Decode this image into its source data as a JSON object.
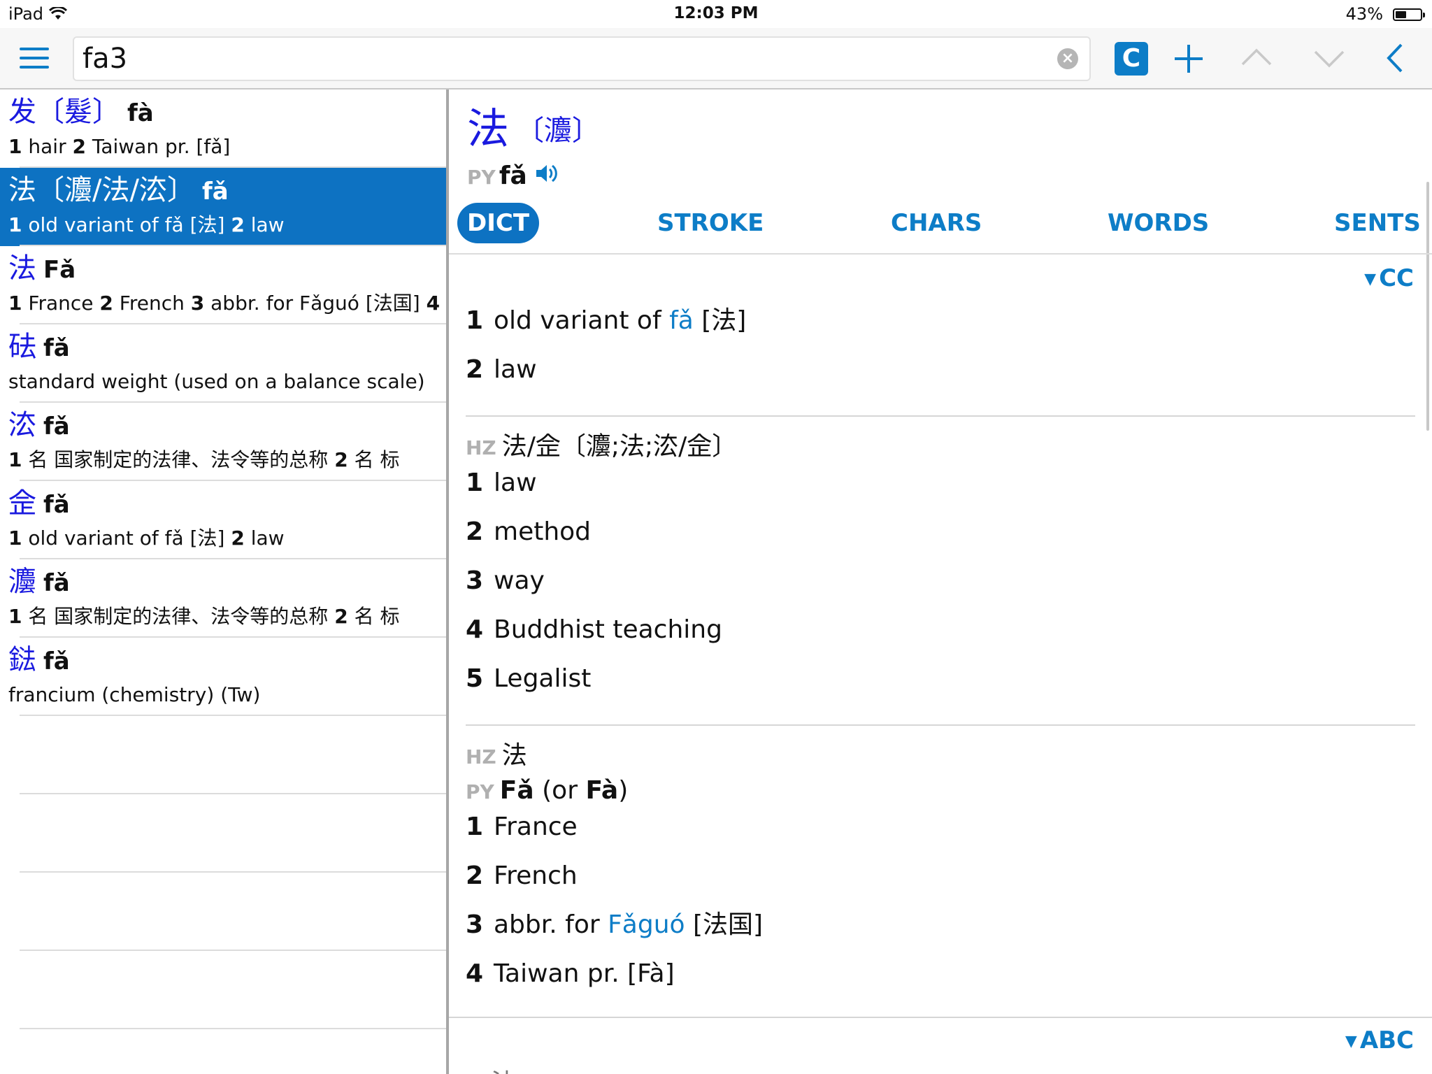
{
  "status_bar": {
    "device": "iPad",
    "time": "12:03 PM",
    "battery_percent": "43%",
    "battery_level": 0.43
  },
  "toolbar": {
    "search_value": "fa3",
    "c_button_label": "C",
    "accent_color": "#0d7dc7"
  },
  "results": [
    {
      "hz": "发",
      "trad": "〔髮〕",
      "py": "fà",
      "defs": [
        {
          "num": "1",
          "text": " hair "
        },
        {
          "num": "2",
          "text": " Taiwan pr. [fǎ]"
        }
      ]
    },
    {
      "hz": "法",
      "trad": "〔灋/法/㳒〕",
      "py": "fǎ",
      "selected": true,
      "defs": [
        {
          "num": "1",
          "text": " old variant of fǎ [法] "
        },
        {
          "num": "2",
          "text": " law"
        }
      ]
    },
    {
      "hz": "法",
      "trad": "",
      "py": "Fǎ",
      "defs": [
        {
          "num": "1",
          "text": " France "
        },
        {
          "num": "2",
          "text": " French "
        },
        {
          "num": "3",
          "text": " abbr. for Fǎguó [法国] "
        },
        {
          "num": "4",
          "text": ""
        }
      ]
    },
    {
      "hz": "砝",
      "trad": "",
      "py": "fǎ",
      "defs": [
        {
          "num": "",
          "text": "standard weight (used on a balance scale)"
        }
      ]
    },
    {
      "hz": "㳒",
      "trad": "",
      "py": "fǎ",
      "defs": [
        {
          "num": "1",
          "text": " 名 国家制定的法律、法令等的总称 "
        },
        {
          "num": "2",
          "text": " 名 标"
        }
      ]
    },
    {
      "hz": "佱",
      "trad": "",
      "py": "fǎ",
      "defs": [
        {
          "num": "1",
          "text": " old variant of fǎ [法] "
        },
        {
          "num": "2",
          "text": " law"
        }
      ]
    },
    {
      "hz": "灋",
      "trad": "",
      "py": "fǎ",
      "defs": [
        {
          "num": "1",
          "text": " 名 国家制定的法律、法令等的总称 "
        },
        {
          "num": "2",
          "text": " 名 标"
        }
      ]
    },
    {
      "hz": "鍅",
      "trad": "",
      "py": "fǎ",
      "defs": [
        {
          "num": "",
          "text": "francium (chemistry) (Tw)"
        }
      ]
    }
  ],
  "detail": {
    "headword": "法",
    "trad": "〔灋〕",
    "py_label": "PY",
    "py": "fǎ",
    "tabs": [
      "DICT",
      "STROKE",
      "CHARS",
      "WORDS",
      "SENTS"
    ],
    "active_tab": "DICT",
    "source_cc": "CC",
    "source_abc": "ABC",
    "cc_defs": [
      {
        "num": "1",
        "pre": "old variant of ",
        "link": "fǎ",
        "post": " [法]"
      },
      {
        "num": "2",
        "pre": "law",
        "link": "",
        "post": ""
      }
    ],
    "hz_label": "HZ",
    "section2_hz": "法/佱〔灋;法;㳒/佱〕",
    "section2_defs": [
      {
        "num": "1",
        "text": "law"
      },
      {
        "num": "2",
        "text": "method"
      },
      {
        "num": "3",
        "text": "way"
      },
      {
        "num": "4",
        "text": "Buddhist teaching"
      },
      {
        "num": "5",
        "text": "Legalist"
      }
    ],
    "section3_hz": "法",
    "section3_py_bold": "Fǎ",
    "section3_py_mid": " (or ",
    "section3_py_bold2": "Fà",
    "section3_py_end": ")",
    "section3_defs": [
      {
        "num": "1",
        "pre": "France",
        "link": "",
        "post": ""
      },
      {
        "num": "2",
        "pre": "French",
        "link": "",
        "post": ""
      },
      {
        "num": "3",
        "pre": "abbr. for ",
        "link": "Fǎguó",
        "post": " [法国]"
      },
      {
        "num": "4",
        "pre": "Taiwan pr. [Fà]",
        "link": "",
        "post": ""
      }
    ],
    "bottom_peek": "法"
  }
}
